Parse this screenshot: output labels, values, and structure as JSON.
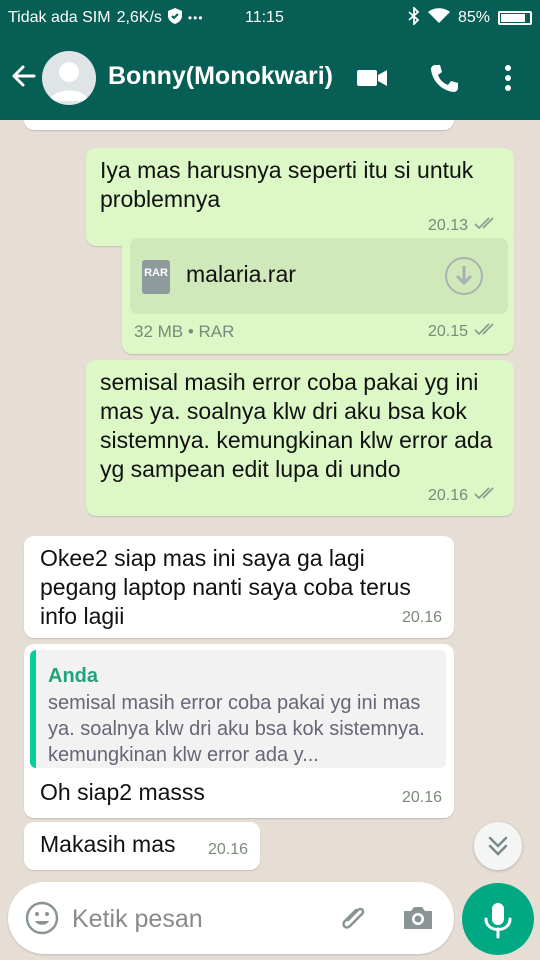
{
  "statusbar": {
    "carrier": "Tidak ada SIM",
    "speed": "2,6K/s",
    "dots": "•••",
    "time": "11:15",
    "battery": "85%",
    "battery_level": 0.85
  },
  "header": {
    "contact_name": "Bonny(Monokwari)"
  },
  "messages": [
    {
      "text": "Iya mas harusnya seperti itu si untuk problemnya",
      "time": "20.13"
    },
    {
      "file_name": "malaria.rar",
      "file_type_icon": "RAR",
      "file_info": "32 MB • RAR",
      "time": "20.15"
    },
    {
      "text": "semisal masih error coba pakai yg ini mas ya. soalnya klw dri aku bsa kok sistemnya. kemungkinan klw error ada yg sampean edit lupa di undo",
      "time": "20.16"
    },
    {
      "text": "Okee2 siap mas ini saya ga lagi pegang laptop nanti saya coba terus info lagii",
      "time": "20.16"
    },
    {
      "quote_author": "Anda",
      "quote_text": "semisal masih error coba pakai yg ini mas ya. soalnya klw dri aku bsa kok sistemnya. kemungkinan klw error ada y...",
      "text": "Oh siap2 masss",
      "time": "20.16"
    },
    {
      "text": "Makasih mas",
      "time": "20.16"
    }
  ],
  "composer": {
    "placeholder": "Ketik pesan"
  },
  "colors": {
    "header": "#075e54",
    "outgoing_bubble": "#dcf8c6",
    "incoming_bubble": "#ffffff",
    "mic_button": "#00a884",
    "quote_accent": "#06cf9c"
  }
}
